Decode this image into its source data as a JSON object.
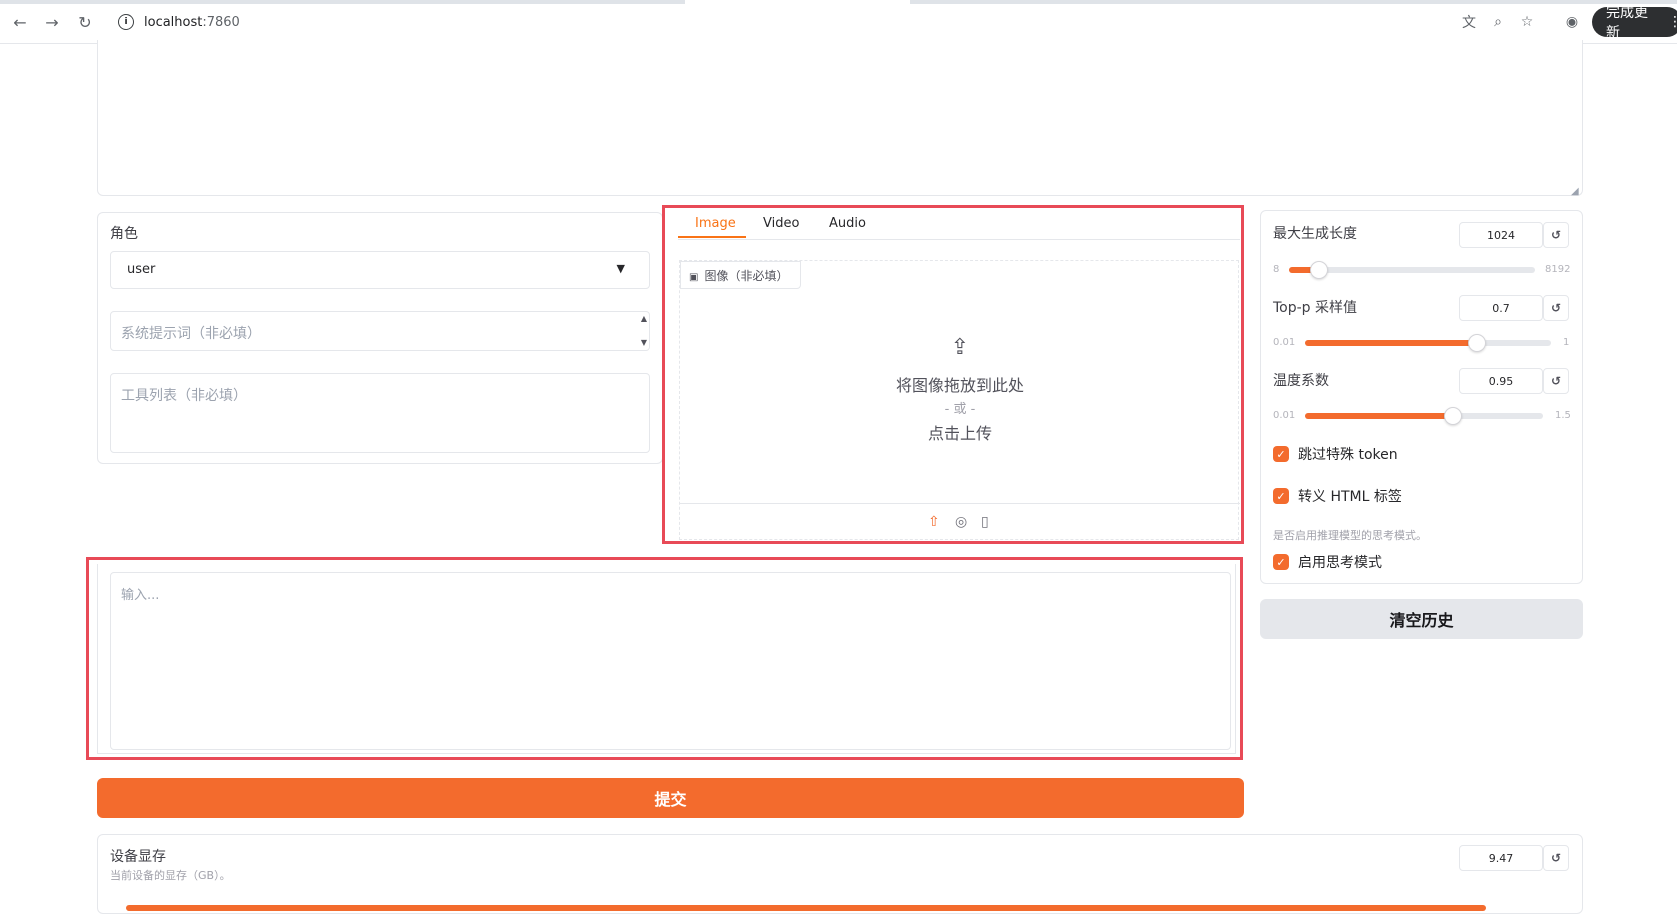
{
  "browser": {
    "url_host": "localhost",
    "url_port": ":7860",
    "update_button_label": "完成更新",
    "icons": [
      "back-arrow-icon",
      "forward-arrow-icon",
      "reload-icon",
      "site-info-icon",
      "translate-icon",
      "zoom-icon",
      "star-icon",
      "profile-icon",
      "more-icon"
    ]
  },
  "left_panel": {
    "role_label": "角色",
    "role_value": "user",
    "system_prompt_placeholder": "系统提示词（非必填）",
    "tools_placeholder": "工具列表（非必填）"
  },
  "media": {
    "tabs": [
      "Image",
      "Video",
      "Audio"
    ],
    "active_tab": "Image",
    "image_label": "图像（非必填）",
    "drop_text": "将图像拖放到此处",
    "or_text": "- 或 -",
    "click_text": "点击上传",
    "source_icons": [
      "upload-icon",
      "webcam-icon",
      "clipboard-icon"
    ]
  },
  "chat_input": {
    "placeholder": "输入..."
  },
  "submit_label": "提交",
  "settings": {
    "max_len": {
      "label": "最大生成长度",
      "value": "1024",
      "min": "8",
      "max": "8192",
      "fraction": 0.12
    },
    "top_p": {
      "label": "Top-p 采样值",
      "value": "0.7",
      "min": "0.01",
      "max": "1",
      "fraction": 0.7
    },
    "temperature": {
      "label": "温度系数",
      "value": "0.95",
      "min": "0.01",
      "max": "1.5",
      "fraction": 0.62
    },
    "skip_special_tokens": {
      "label": "跳过特殊 token",
      "checked": true
    },
    "escape_html": {
      "label": "转义 HTML 标签",
      "checked": true
    },
    "thinking_hint": "是否启用推理模型的思考模式。",
    "enable_thinking": {
      "label": "启用思考模式",
      "checked": true
    },
    "reset_symbol": "↺",
    "check_symbol": "✓"
  },
  "clear_history_label": "清空历史",
  "device_memory": {
    "label": "设备显存",
    "info": "当前设备的显存（GB）。",
    "value": "9.47"
  },
  "colors": {
    "accent": "#f36b2d",
    "highlight_box": "#e84a57"
  }
}
